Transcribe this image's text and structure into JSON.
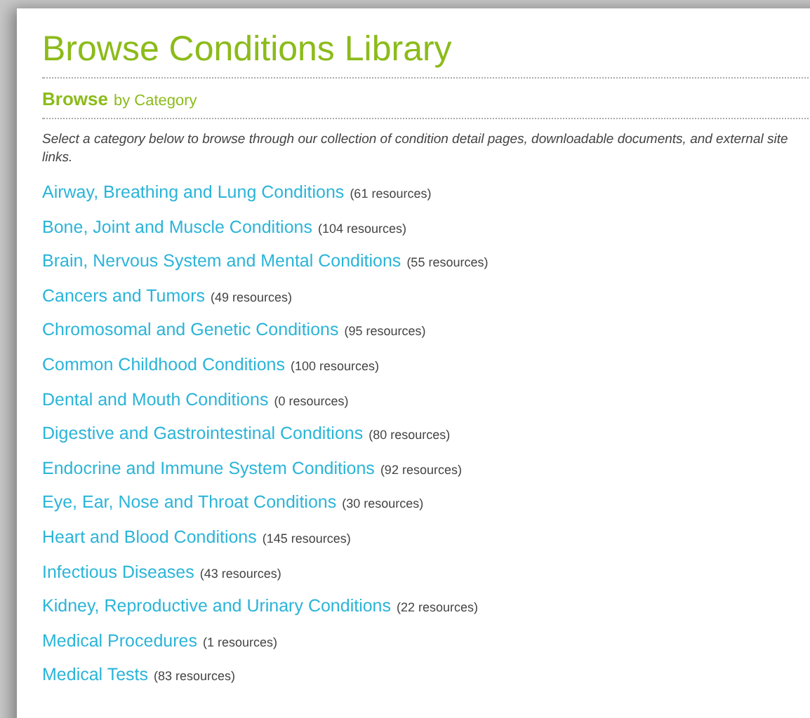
{
  "title": "Browse Conditions Library",
  "subheading": {
    "strong": "Browse",
    "rest": "by Category"
  },
  "intro": "Select a category below to browse through our collection of condition detail pages, downloadable documents, and external site links.",
  "categories": [
    {
      "name": "Airway, Breathing and Lung Conditions",
      "count": "(61 resources)"
    },
    {
      "name": "Bone, Joint and Muscle Conditions",
      "count": "(104 resources)"
    },
    {
      "name": "Brain, Nervous System and Mental Conditions",
      "count": "(55 resources)"
    },
    {
      "name": "Cancers and Tumors",
      "count": "(49 resources)"
    },
    {
      "name": "Chromosomal and Genetic Conditions",
      "count": "(95 resources)"
    },
    {
      "name": "Common Childhood Conditions",
      "count": "(100 resources)"
    },
    {
      "name": "Dental and Mouth Conditions",
      "count": "(0 resources)"
    },
    {
      "name": "Digestive and Gastrointestinal Conditions",
      "count": "(80 resources)"
    },
    {
      "name": "Endocrine and Immune System Conditions",
      "count": "(92 resources)"
    },
    {
      "name": "Eye, Ear, Nose and Throat Conditions",
      "count": "(30 resources)"
    },
    {
      "name": "Heart and Blood Conditions",
      "count": "(145 resources)"
    },
    {
      "name": "Infectious Diseases",
      "count": "(43 resources)"
    },
    {
      "name": "Kidney, Reproductive and Urinary Conditions",
      "count": "(22 resources)"
    },
    {
      "name": "Medical Procedures",
      "count": "(1 resources)"
    },
    {
      "name": "Medical Tests",
      "count": "(83 resources)"
    }
  ]
}
